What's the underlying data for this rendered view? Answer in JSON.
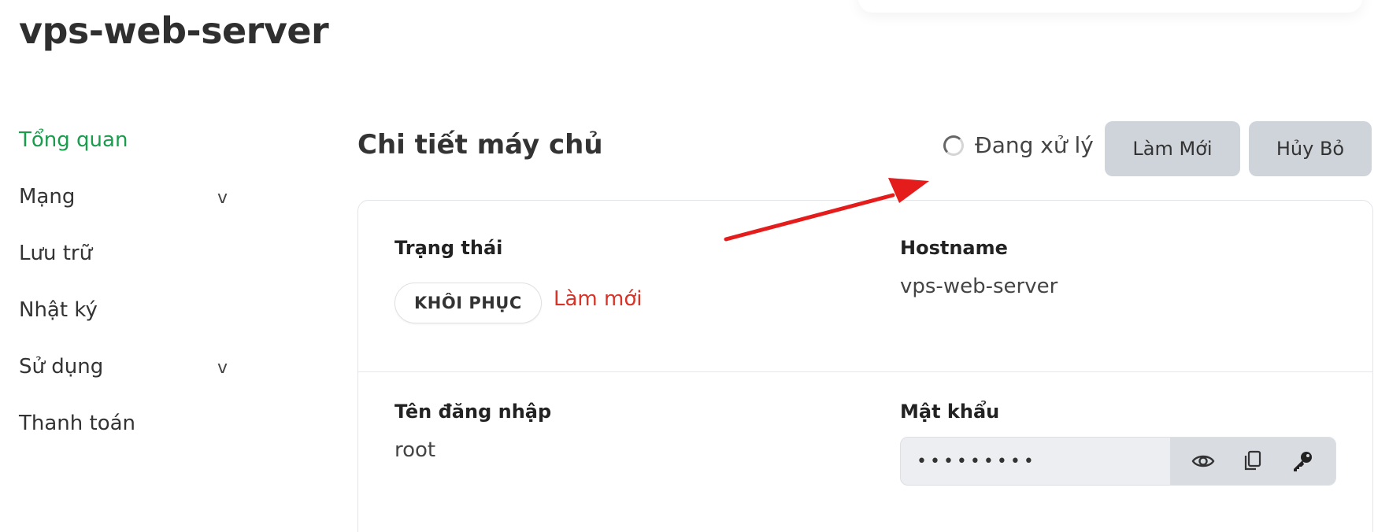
{
  "server": {
    "title": "vps-web-server"
  },
  "sidebar": {
    "items": [
      {
        "label": "Tổng quan",
        "active": true,
        "has_chevron": false
      },
      {
        "label": "Mạng",
        "active": false,
        "has_chevron": true
      },
      {
        "label": "Lưu trữ",
        "active": false,
        "has_chevron": false
      },
      {
        "label": "Nhật ký",
        "active": false,
        "has_chevron": false
      },
      {
        "label": "Sử dụng",
        "active": false,
        "has_chevron": true
      },
      {
        "label": "Thanh toán",
        "active": false,
        "has_chevron": false
      }
    ],
    "chevron_glyph": "v"
  },
  "details": {
    "title": "Chi tiết máy chủ",
    "processing_text": "Đang xử lý",
    "refresh_button": "Làm Mới",
    "cancel_button": "Hủy Bỏ"
  },
  "fields": {
    "status_label": "Trạng thái",
    "status_badge": "KHÔI PHỤC",
    "status_link": "Làm mới",
    "hostname_label": "Hostname",
    "hostname_value": "vps-web-server",
    "username_label": "Tên đăng nhập",
    "username_value": "root",
    "password_label": "Mật khẩu",
    "password_masked": "•••••••••"
  },
  "icons": {
    "show_password": "eye-icon",
    "copy_password": "copy-icon",
    "reset_password": "key-icon",
    "processing": "spinner-icon"
  },
  "colors": {
    "active_nav": "#1a9c4d",
    "status_link": "#d93226",
    "annotation_arrow": "#e51c1c",
    "button_bg": "#cfd4da"
  }
}
